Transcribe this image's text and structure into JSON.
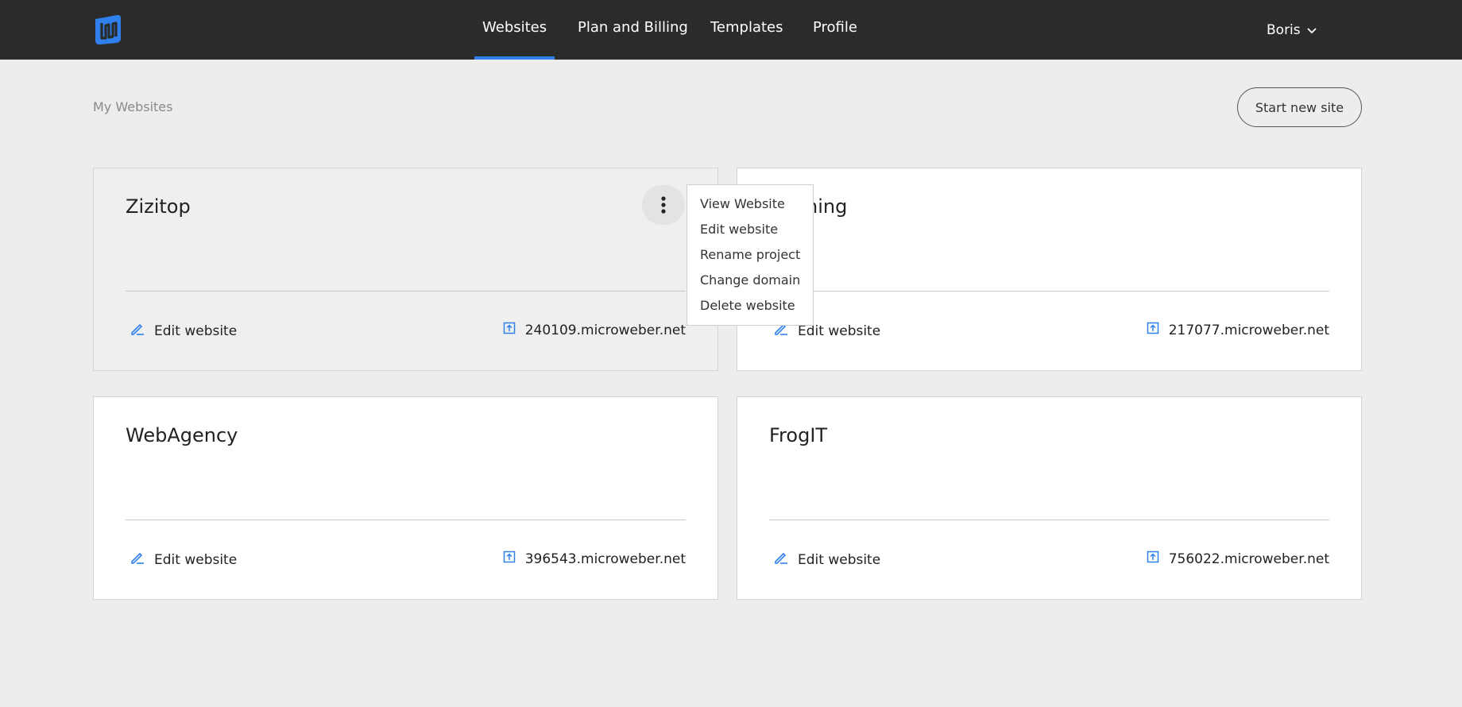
{
  "navbar": {
    "logo": "microweber-logo",
    "items": [
      {
        "label": "Websites",
        "active": true
      },
      {
        "label": "Plan and Billing",
        "active": false
      },
      {
        "label": "Templates",
        "active": false
      },
      {
        "label": "Profile",
        "active": false
      }
    ],
    "user": {
      "name": "Boris",
      "icon": "chevron-down-icon"
    },
    "accent_color": "#2f80ed",
    "background_color": "#2b2b2b"
  },
  "page": {
    "breadcrumb": "My Websites",
    "start_new_label": "Start new site"
  },
  "cards": [
    {
      "title": "Zizitop",
      "edit_label": "Edit website",
      "domain": "240109.microweber.net",
      "menu_open": true
    },
    {
      "title": "Running",
      "edit_label": "Edit website",
      "domain": "217077.microweber.net",
      "menu_open": false
    },
    {
      "title": "WebAgency",
      "edit_label": "Edit website",
      "domain": "396543.microweber.net",
      "menu_open": false
    },
    {
      "title": "FrogIT",
      "edit_label": "Edit website",
      "domain": "756022.microweber.net",
      "menu_open": false
    }
  ],
  "context_menu": {
    "items": [
      "View Website",
      "Edit website",
      "Rename project",
      "Change domain",
      "Delete website"
    ]
  },
  "icons": {
    "edit": "pencil-icon",
    "domain": "external-link-icon",
    "menu": "kebab-menu-icon"
  }
}
